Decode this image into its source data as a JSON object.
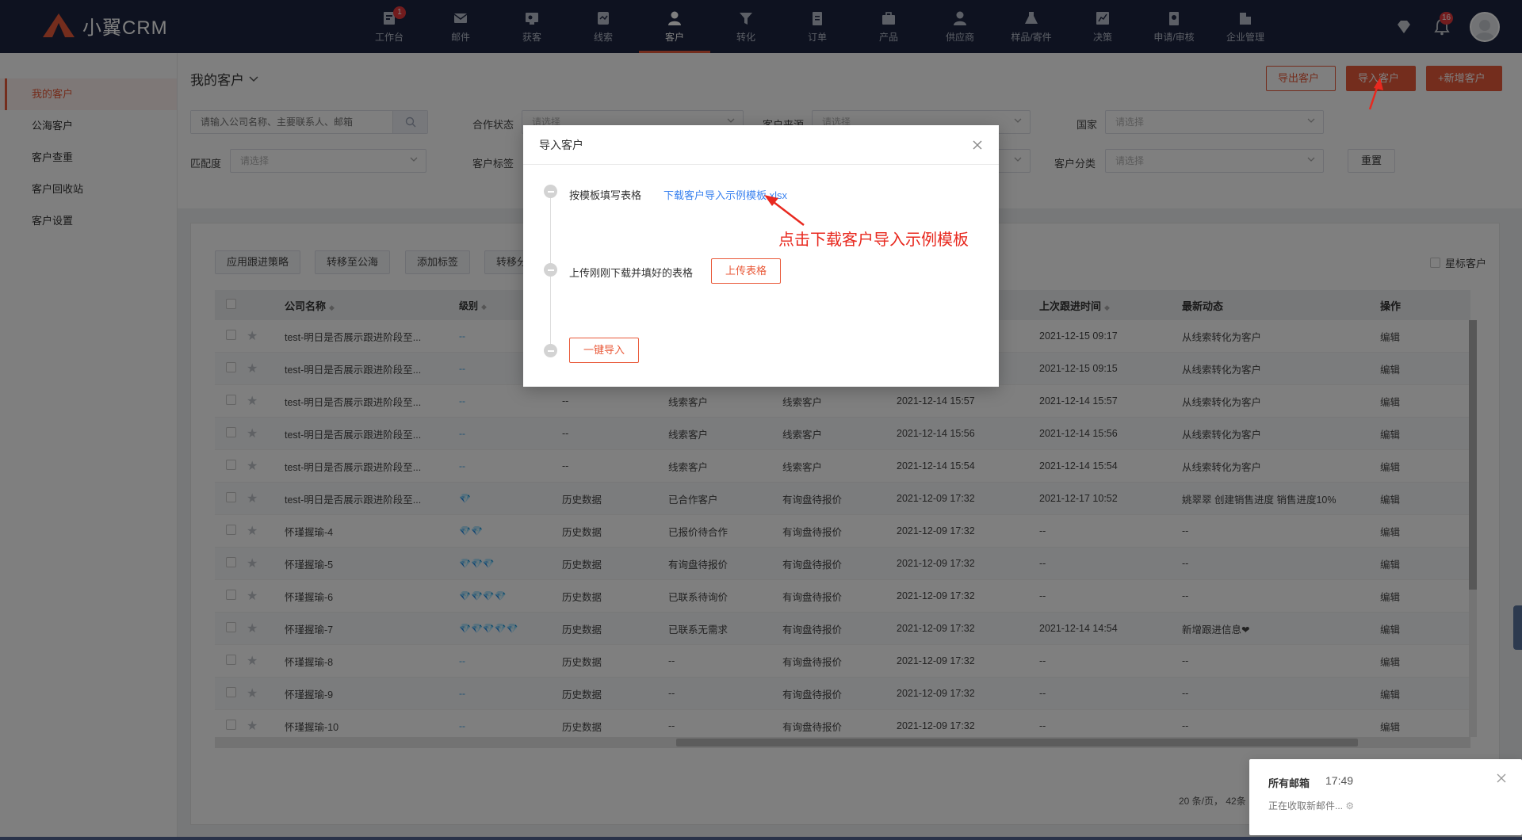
{
  "app": {
    "brand": "小翼CRM"
  },
  "nav": [
    {
      "label": "工作台",
      "icon": "dashboard-icon",
      "badge": "1"
    },
    {
      "label": "邮件",
      "icon": "mail-icon"
    },
    {
      "label": "获客",
      "icon": "acquire-icon"
    },
    {
      "label": "线索",
      "icon": "leads-icon"
    },
    {
      "label": "客户",
      "icon": "customer-icon",
      "active": true
    },
    {
      "label": "转化",
      "icon": "funnel-icon"
    },
    {
      "label": "订单",
      "icon": "order-icon"
    },
    {
      "label": "产品",
      "icon": "product-icon"
    },
    {
      "label": "供应商",
      "icon": "supplier-icon"
    },
    {
      "label": "样品/寄件",
      "icon": "sample-icon"
    },
    {
      "label": "决策",
      "icon": "chart-icon"
    },
    {
      "label": "申请/审核",
      "icon": "approval-icon"
    },
    {
      "label": "企业管理",
      "icon": "enterprise-icon"
    }
  ],
  "topright": {
    "bell_badge": "16"
  },
  "sidebar": {
    "items": [
      {
        "label": "我的客户",
        "active": true
      },
      {
        "label": "公海客户"
      },
      {
        "label": "客户查重"
      },
      {
        "label": "客户回收站"
      },
      {
        "label": "客户设置"
      }
    ]
  },
  "header": {
    "title": "我的客户",
    "export_label": "导出客户",
    "import_label": "导入客户",
    "new_label": "+新增客户"
  },
  "filters": {
    "search_placeholder": "请输入公司名称、主要联系人、邮箱",
    "coop_label": "合作状态",
    "source_label": "客户来源",
    "country_label": "国家",
    "match_label": "匹配度",
    "tag_label": "客户标签",
    "category_label": "客户分类",
    "placeholder": "请选择",
    "reset_label": "重置"
  },
  "toolbar": {
    "apply_strategy": "应用跟进策略",
    "to_public": "转移至公海",
    "add_tag": "添加标签",
    "transfer": "转移分",
    "star_filter": "星标客户"
  },
  "table": {
    "headers": {
      "company": "公司名称",
      "level": "级别",
      "last_follow": "上次跟进时间",
      "news": "最新动态",
      "op": "操作"
    },
    "rows": [
      {
        "company": "test-明日是否展示跟进阶段至...",
        "level": "--",
        "source": "",
        "stage": "",
        "type": "",
        "created": "",
        "last": "2021-12-15 09:17",
        "news": "从线索转化为客户",
        "op": "编辑"
      },
      {
        "company": "test-明日是否展示跟进阶段至...",
        "level": "--",
        "source": "",
        "stage": "",
        "type": "",
        "created": "",
        "last": "2021-12-15 09:15",
        "news": "从线索转化为客户",
        "op": "编辑"
      },
      {
        "company": "test-明日是否展示跟进阶段至...",
        "level": "--",
        "source": "--",
        "stage": "线索客户",
        "type": "线索客户",
        "created": "2021-12-14 15:57",
        "last": "2021-12-14 15:57",
        "news": "从线索转化为客户",
        "op": "编辑"
      },
      {
        "company": "test-明日是否展示跟进阶段至...",
        "level": "--",
        "source": "--",
        "stage": "线索客户",
        "type": "线索客户",
        "created": "2021-12-14 15:56",
        "last": "2021-12-14 15:56",
        "news": "从线索转化为客户",
        "op": "编辑"
      },
      {
        "company": "test-明日是否展示跟进阶段至...",
        "level": "--",
        "source": "--",
        "stage": "线索客户",
        "type": "线索客户",
        "created": "2021-12-14 15:54",
        "last": "2021-12-14 15:54",
        "news": "从线索转化为客户",
        "op": "编辑"
      },
      {
        "company": "test-明日是否展示跟进阶段至...",
        "level": "💎",
        "source": "历史数据",
        "stage": "已合作客户",
        "type": "有询盘待报价",
        "created": "2021-12-09 17:32",
        "last": "2021-12-17 10:52",
        "news": "姚翠翠 创建销售进度 销售进度10%",
        "op": "编辑"
      },
      {
        "company": "怀瑾握瑜-4",
        "level": "💎💎",
        "source": "历史数据",
        "stage": "已报价待合作",
        "type": "有询盘待报价",
        "created": "2021-12-09 17:32",
        "last": "--",
        "news": "--",
        "op": "编辑"
      },
      {
        "company": "怀瑾握瑜-5",
        "level": "💎💎💎",
        "source": "历史数据",
        "stage": "有询盘待报价",
        "type": "有询盘待报价",
        "created": "2021-12-09 17:32",
        "last": "--",
        "news": "--",
        "op": "编辑"
      },
      {
        "company": "怀瑾握瑜-6",
        "level": "💎💎💎💎",
        "source": "历史数据",
        "stage": "已联系待询价",
        "type": "有询盘待报价",
        "created": "2021-12-09 17:32",
        "last": "--",
        "news": "--",
        "op": "编辑"
      },
      {
        "company": "怀瑾握瑜-7",
        "level": "💎💎💎💎💎",
        "source": "历史数据",
        "stage": "已联系无需求",
        "type": "有询盘待报价",
        "created": "2021-12-09 17:32",
        "last": "2021-12-14 14:54",
        "news": "新增跟进信息❤",
        "op": "编辑"
      },
      {
        "company": "怀瑾握瑜-8",
        "level": "--",
        "source": "历史数据",
        "stage": "--",
        "type": "有询盘待报价",
        "created": "2021-12-09 17:32",
        "last": "--",
        "news": "--",
        "op": "编辑"
      },
      {
        "company": "怀瑾握瑜-9",
        "level": "--",
        "source": "历史数据",
        "stage": "--",
        "type": "有询盘待报价",
        "created": "2021-12-09 17:32",
        "last": "--",
        "news": "--",
        "op": "编辑"
      },
      {
        "company": "怀瑾握瑜-10",
        "level": "--",
        "source": "历史数据",
        "stage": "--",
        "type": "有询盘待报价",
        "created": "2021-12-09 17:32",
        "last": "--",
        "news": "--",
        "op": "编辑"
      }
    ]
  },
  "pager": {
    "text": "20 条/页， 42条"
  },
  "modal": {
    "title": "导入客户",
    "step1_label": "按模板填写表格",
    "step1_link": "下载客户导入示例模板.xlsx",
    "step2_label": "上传刚刚下载并填好的表格",
    "upload_label": "上传表格",
    "onekey_label": "一键导入"
  },
  "annotation": {
    "text": "点击下载客户导入示例模板"
  },
  "toast": {
    "title": "所有邮箱",
    "time": "17:49",
    "message": "正在收取新邮件..."
  },
  "colors": {
    "accent": "#e95a3a",
    "nav_bg": "#1c2540",
    "link": "#3a82ef",
    "annotation": "#e8291f"
  }
}
